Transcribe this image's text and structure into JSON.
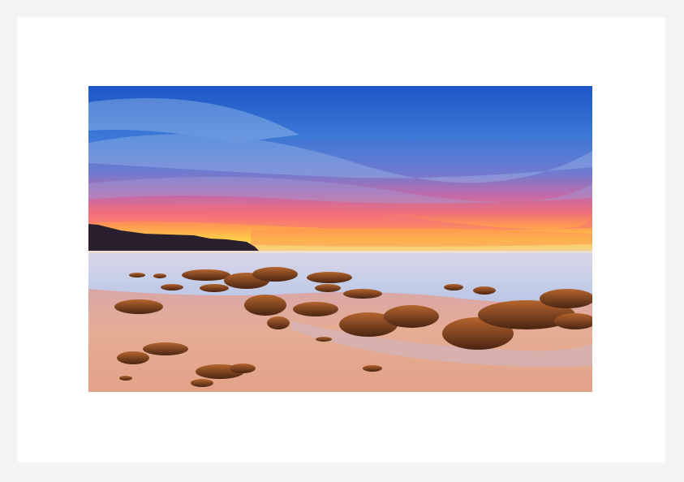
{
  "artwork": {
    "subject": "",
    "colors": {
      "frame": "#f3f3f5",
      "mat": "#ffffff",
      "sky_top": "#1c56c6",
      "sky_mid": "#3f79d4",
      "horizon_glow": "#ffb13a",
      "sunset_red": "#e8566a",
      "sea": "#c9d1e8",
      "sand": "#e5ab90",
      "rock": "#7a3d1e"
    }
  }
}
